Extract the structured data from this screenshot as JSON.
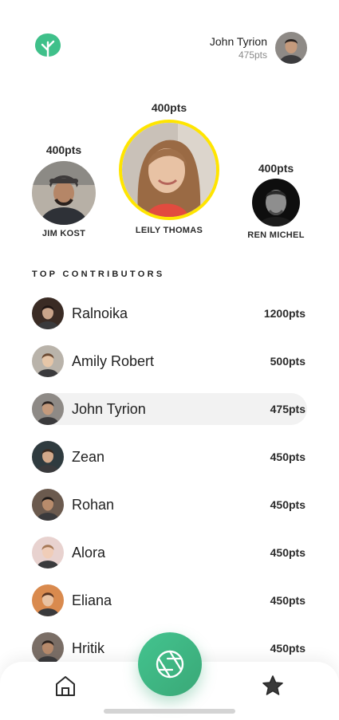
{
  "header": {
    "logo_icon": "tree-icon",
    "brand_color": "#3fc08a",
    "user": {
      "name": "John Tyrion",
      "points": "475pts"
    }
  },
  "podium": {
    "first": {
      "name": "LEILY THOMAS",
      "points": "400pts",
      "ring_color": "#ffe500"
    },
    "second": {
      "name": "JIM KOST",
      "points": "400pts"
    },
    "third": {
      "name": "REN MICHEL",
      "points": "400pts"
    }
  },
  "section_title": "TOP CONTRIBUTORS",
  "contributors": [
    {
      "name": "Ralnoika",
      "points": "1200pts",
      "bg": "#3a2b24",
      "skin": "#c9a48a",
      "hair": "#1e1412"
    },
    {
      "name": "Amily Robert",
      "points": "500pts",
      "bg": "#b9b3aa",
      "skin": "#e6c6a8",
      "hair": "#6b4a33"
    },
    {
      "name": "John Tyrion",
      "points": "475pts",
      "bg": "#8e8a86",
      "skin": "#c49a7c",
      "hair": "#2b2422",
      "current": true
    },
    {
      "name": "Zean",
      "points": "450pts",
      "bg": "#2f3b3f",
      "skin": "#d2a98a",
      "hair": "#3a2a20"
    },
    {
      "name": "Rohan",
      "points": "450pts",
      "bg": "#6b5a4e",
      "skin": "#b88c6c",
      "hair": "#1f1a18"
    },
    {
      "name": "Alora",
      "points": "450pts",
      "bg": "#e8d2cf",
      "skin": "#f0cdb8",
      "hair": "#a57856"
    },
    {
      "name": "Eliana",
      "points": "450pts",
      "bg": "#d98a4e",
      "skin": "#e9c2a2",
      "hair": "#5a3522"
    },
    {
      "name": "Hritik",
      "points": "450pts",
      "bg": "#7a6e66",
      "skin": "#b78a6b",
      "hair": "#2a211d"
    }
  ],
  "nav": {
    "home_icon": "home-icon",
    "camera_icon": "aperture-icon",
    "star_icon": "star-icon",
    "accent": "#3fb882"
  }
}
